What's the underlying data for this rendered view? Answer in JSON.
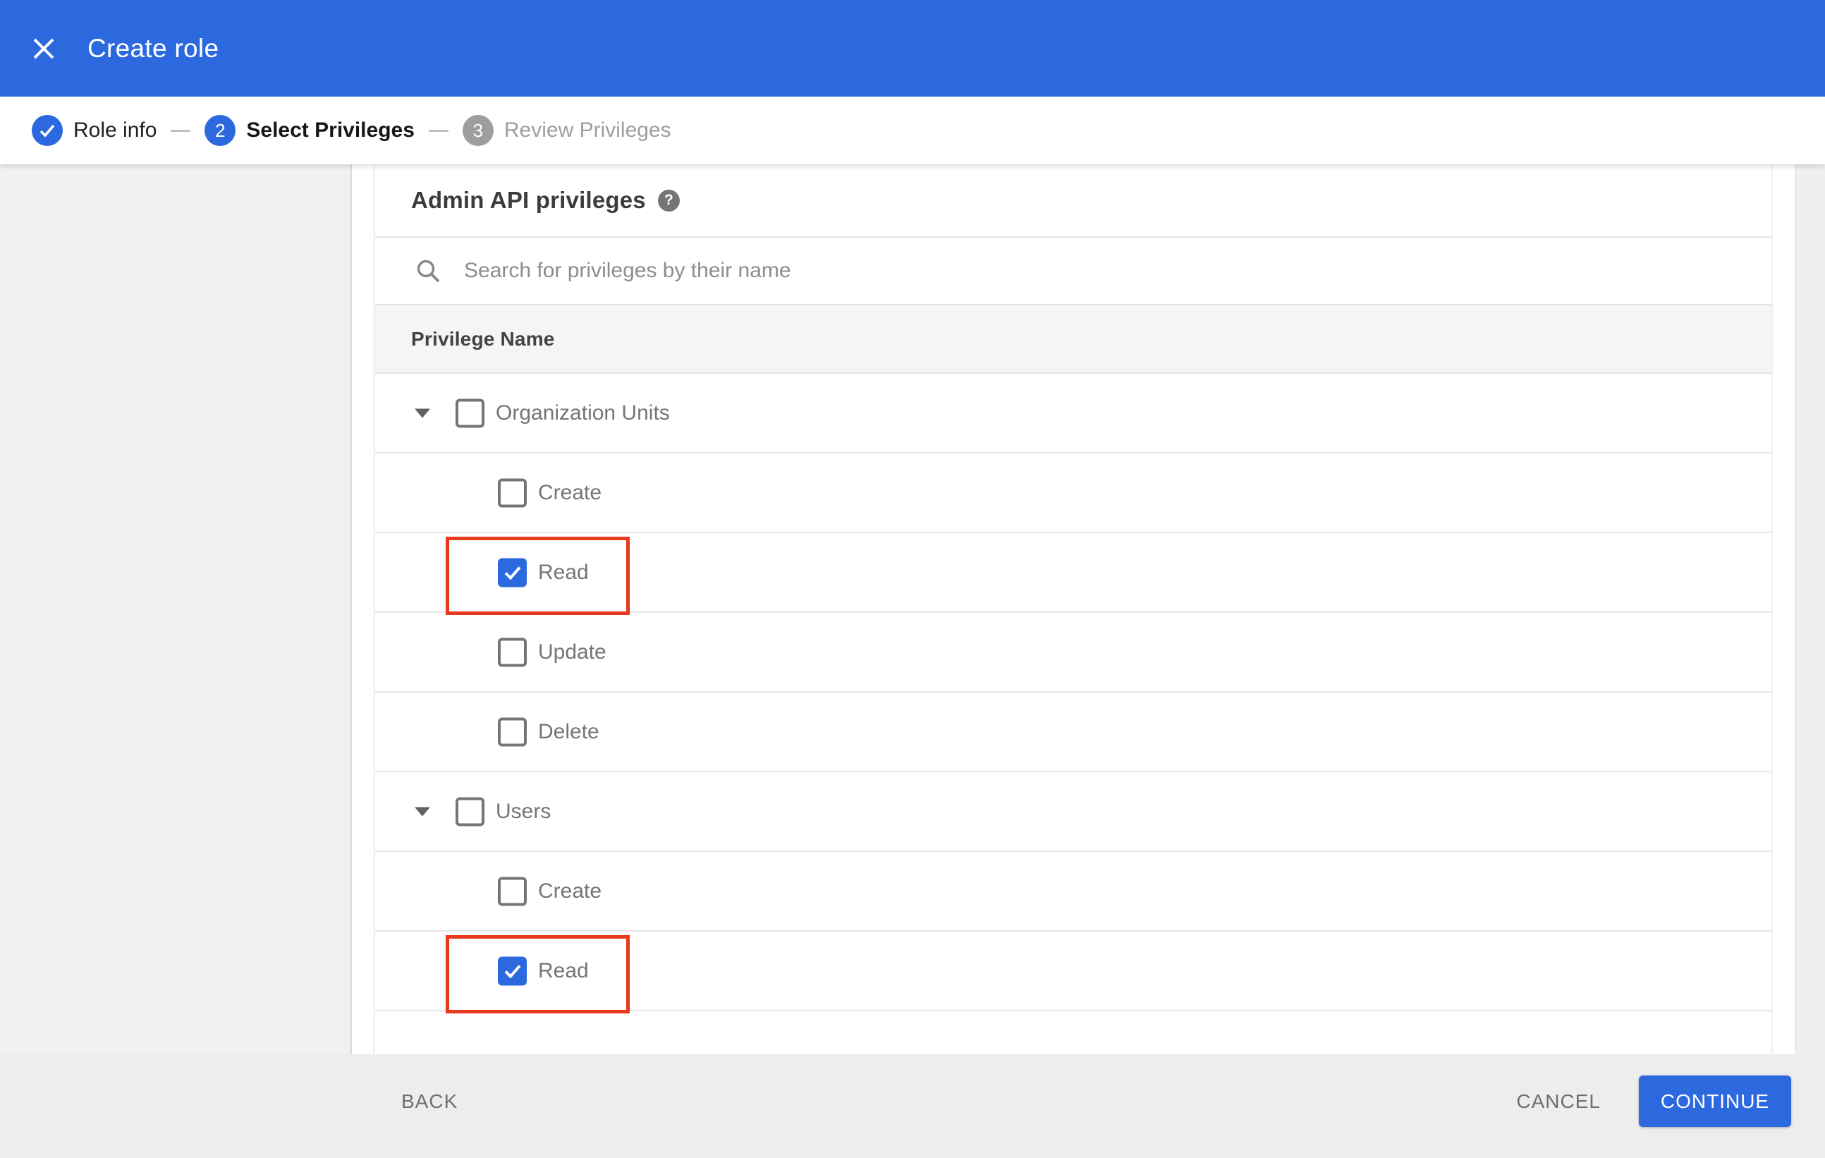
{
  "titlebar": {
    "title": "Create role",
    "close_icon": "close-x-icon"
  },
  "stepper": {
    "steps": [
      {
        "number": "1",
        "label": "Role info",
        "state": "complete",
        "icon": "check-icon"
      },
      {
        "number": "2",
        "label": "Select Privileges",
        "state": "active"
      },
      {
        "number": "3",
        "label": "Review Privileges",
        "state": "upcoming"
      }
    ]
  },
  "privileges_panel": {
    "heading": "Admin API privileges",
    "help_icon": "help-question-icon",
    "search": {
      "placeholder": "Search for privileges by their name",
      "value": "",
      "icon": "search-icon"
    },
    "table": {
      "column_header": "Privilege Name",
      "rows": [
        {
          "label": "Organization Units",
          "level": 0,
          "group": true,
          "expanded": true,
          "checked": false,
          "highlighted": false
        },
        {
          "label": "Create",
          "level": 1,
          "group": false,
          "checked": false,
          "highlighted": false
        },
        {
          "label": "Read",
          "level": 1,
          "group": false,
          "checked": true,
          "highlighted": true
        },
        {
          "label": "Update",
          "level": 1,
          "group": false,
          "checked": false,
          "highlighted": false
        },
        {
          "label": "Delete",
          "level": 1,
          "group": false,
          "checked": false,
          "highlighted": false
        },
        {
          "label": "Users",
          "level": 0,
          "group": true,
          "expanded": true,
          "checked": false,
          "highlighted": false
        },
        {
          "label": "Create",
          "level": 1,
          "group": false,
          "checked": false,
          "highlighted": false
        },
        {
          "label": "Read",
          "level": 1,
          "group": false,
          "checked": true,
          "highlighted": true
        }
      ]
    }
  },
  "footer": {
    "back_label": "BACK",
    "cancel_label": "CANCEL",
    "continue_label": "CONTINUE"
  },
  "colors": {
    "accent_blue": "#2c69de",
    "highlight_red": "#e8391f",
    "sidebar_gray": "#f1f1f1",
    "footer_gray": "#ededed",
    "table_header_gray": "#f5f5f5",
    "label_gray": "#757575"
  }
}
